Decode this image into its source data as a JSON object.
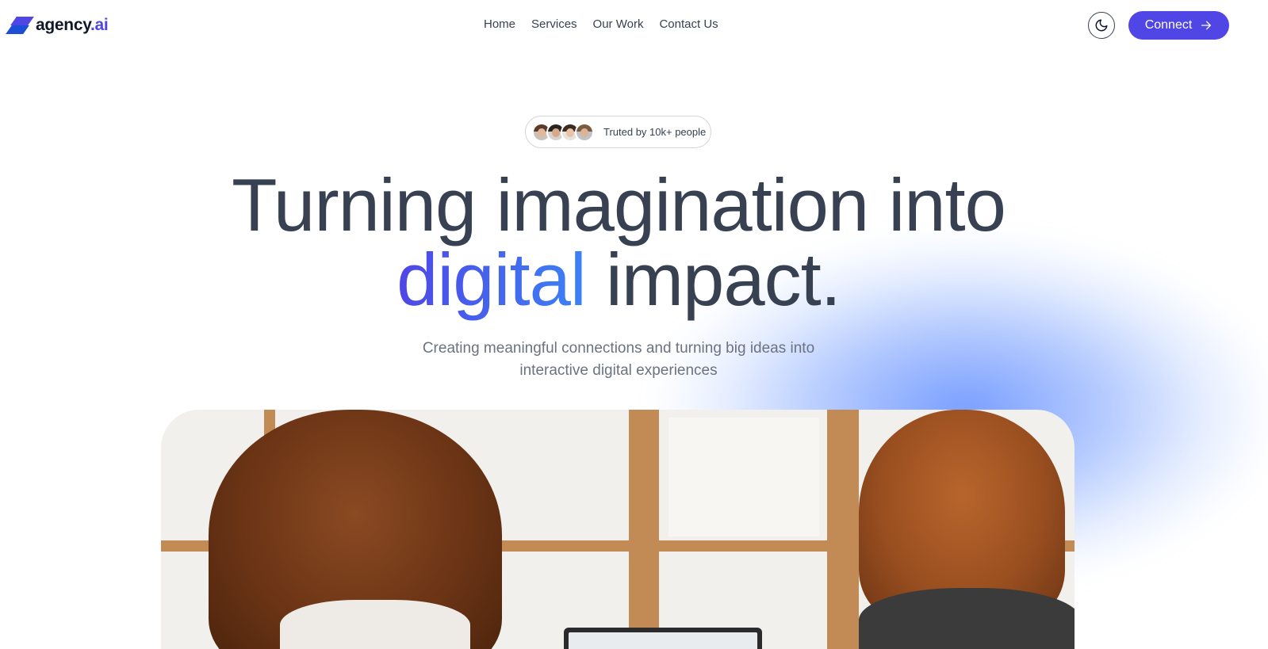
{
  "brand": {
    "name": "agency",
    "suffix": ".ai",
    "accent_color": "#4f46e5"
  },
  "nav": {
    "items": [
      {
        "label": "Home"
      },
      {
        "label": "Services"
      },
      {
        "label": "Our Work"
      },
      {
        "label": "Contact Us"
      }
    ]
  },
  "header": {
    "theme_toggle_icon": "moon-icon",
    "connect_label": "Connect",
    "connect_icon": "arrow-right-icon"
  },
  "badge": {
    "text": "Truted by 10k+ people"
  },
  "hero": {
    "title_line1": "Turning imagination into",
    "title_accent": "digital",
    "title_line2_rest": " impact.",
    "subtitle_line1": "Creating meaningful connections and turning big ideas into",
    "subtitle_line2": "interactive digital experiences"
  },
  "colors": {
    "primary": "#4f46e5",
    "text_dark": "#374151",
    "text_muted": "#6b7280",
    "glow": "#608cff"
  }
}
